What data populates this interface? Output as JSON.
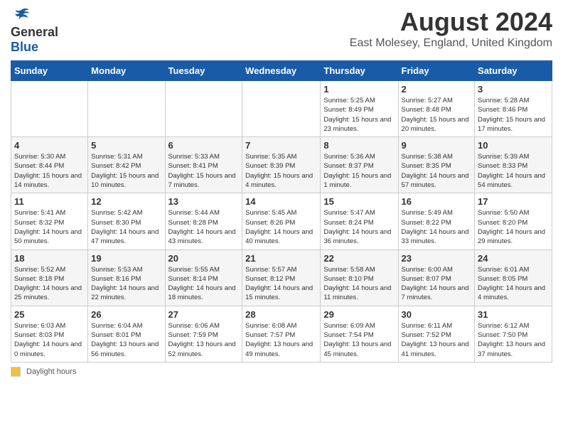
{
  "header": {
    "logo_general": "General",
    "logo_blue": "Blue",
    "main_title": "August 2024",
    "sub_title": "East Molesey, England, United Kingdom"
  },
  "calendar": {
    "days_of_week": [
      "Sunday",
      "Monday",
      "Tuesday",
      "Wednesday",
      "Thursday",
      "Friday",
      "Saturday"
    ],
    "weeks": [
      [
        {
          "day": "",
          "info": ""
        },
        {
          "day": "",
          "info": ""
        },
        {
          "day": "",
          "info": ""
        },
        {
          "day": "",
          "info": ""
        },
        {
          "day": "1",
          "info": "Sunrise: 5:25 AM\nSunset: 8:49 PM\nDaylight: 15 hours and 23 minutes."
        },
        {
          "day": "2",
          "info": "Sunrise: 5:27 AM\nSunset: 8:48 PM\nDaylight: 15 hours and 20 minutes."
        },
        {
          "day": "3",
          "info": "Sunrise: 5:28 AM\nSunset: 8:46 PM\nDaylight: 15 hours and 17 minutes."
        }
      ],
      [
        {
          "day": "4",
          "info": "Sunrise: 5:30 AM\nSunset: 8:44 PM\nDaylight: 15 hours and 14 minutes."
        },
        {
          "day": "5",
          "info": "Sunrise: 5:31 AM\nSunset: 8:42 PM\nDaylight: 15 hours and 10 minutes."
        },
        {
          "day": "6",
          "info": "Sunrise: 5:33 AM\nSunset: 8:41 PM\nDaylight: 15 hours and 7 minutes."
        },
        {
          "day": "7",
          "info": "Sunrise: 5:35 AM\nSunset: 8:39 PM\nDaylight: 15 hours and 4 minutes."
        },
        {
          "day": "8",
          "info": "Sunrise: 5:36 AM\nSunset: 8:37 PM\nDaylight: 15 hours and 1 minute."
        },
        {
          "day": "9",
          "info": "Sunrise: 5:38 AM\nSunset: 8:35 PM\nDaylight: 14 hours and 57 minutes."
        },
        {
          "day": "10",
          "info": "Sunrise: 5:39 AM\nSunset: 8:33 PM\nDaylight: 14 hours and 54 minutes."
        }
      ],
      [
        {
          "day": "11",
          "info": "Sunrise: 5:41 AM\nSunset: 8:32 PM\nDaylight: 14 hours and 50 minutes."
        },
        {
          "day": "12",
          "info": "Sunrise: 5:42 AM\nSunset: 8:30 PM\nDaylight: 14 hours and 47 minutes."
        },
        {
          "day": "13",
          "info": "Sunrise: 5:44 AM\nSunset: 8:28 PM\nDaylight: 14 hours and 43 minutes."
        },
        {
          "day": "14",
          "info": "Sunrise: 5:45 AM\nSunset: 8:26 PM\nDaylight: 14 hours and 40 minutes."
        },
        {
          "day": "15",
          "info": "Sunrise: 5:47 AM\nSunset: 8:24 PM\nDaylight: 14 hours and 36 minutes."
        },
        {
          "day": "16",
          "info": "Sunrise: 5:49 AM\nSunset: 8:22 PM\nDaylight: 14 hours and 33 minutes."
        },
        {
          "day": "17",
          "info": "Sunrise: 5:50 AM\nSunset: 8:20 PM\nDaylight: 14 hours and 29 minutes."
        }
      ],
      [
        {
          "day": "18",
          "info": "Sunrise: 5:52 AM\nSunset: 8:18 PM\nDaylight: 14 hours and 25 minutes."
        },
        {
          "day": "19",
          "info": "Sunrise: 5:53 AM\nSunset: 8:16 PM\nDaylight: 14 hours and 22 minutes."
        },
        {
          "day": "20",
          "info": "Sunrise: 5:55 AM\nSunset: 8:14 PM\nDaylight: 14 hours and 18 minutes."
        },
        {
          "day": "21",
          "info": "Sunrise: 5:57 AM\nSunset: 8:12 PM\nDaylight: 14 hours and 15 minutes."
        },
        {
          "day": "22",
          "info": "Sunrise: 5:58 AM\nSunset: 8:10 PM\nDaylight: 14 hours and 11 minutes."
        },
        {
          "day": "23",
          "info": "Sunrise: 6:00 AM\nSunset: 8:07 PM\nDaylight: 14 hours and 7 minutes."
        },
        {
          "day": "24",
          "info": "Sunrise: 6:01 AM\nSunset: 8:05 PM\nDaylight: 14 hours and 4 minutes."
        }
      ],
      [
        {
          "day": "25",
          "info": "Sunrise: 6:03 AM\nSunset: 8:03 PM\nDaylight: 14 hours and 0 minutes."
        },
        {
          "day": "26",
          "info": "Sunrise: 6:04 AM\nSunset: 8:01 PM\nDaylight: 13 hours and 56 minutes."
        },
        {
          "day": "27",
          "info": "Sunrise: 6:06 AM\nSunset: 7:59 PM\nDaylight: 13 hours and 52 minutes."
        },
        {
          "day": "28",
          "info": "Sunrise: 6:08 AM\nSunset: 7:57 PM\nDaylight: 13 hours and 49 minutes."
        },
        {
          "day": "29",
          "info": "Sunrise: 6:09 AM\nSunset: 7:54 PM\nDaylight: 13 hours and 45 minutes."
        },
        {
          "day": "30",
          "info": "Sunrise: 6:11 AM\nSunset: 7:52 PM\nDaylight: 13 hours and 41 minutes."
        },
        {
          "day": "31",
          "info": "Sunrise: 6:12 AM\nSunset: 7:50 PM\nDaylight: 13 hours and 37 minutes."
        }
      ]
    ]
  },
  "footer": {
    "daylight_label": "Daylight hours"
  }
}
